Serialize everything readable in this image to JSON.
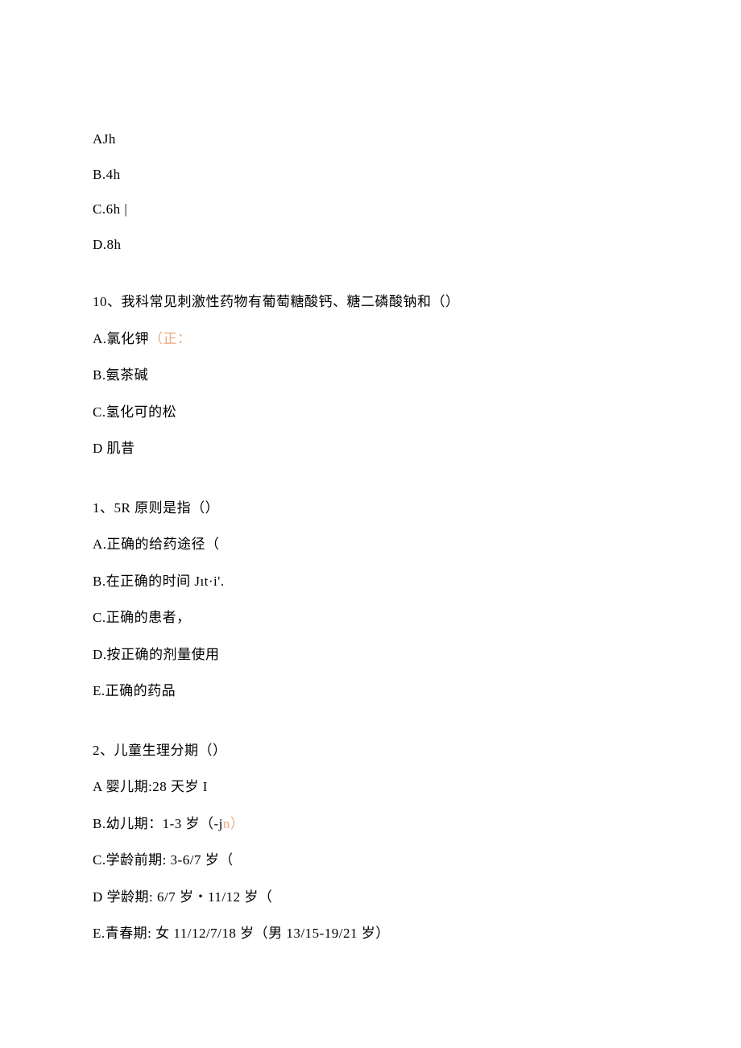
{
  "q9": {
    "optA": "AJh",
    "optB": "B.4h",
    "optC": "C.6h",
    "optD": "D.8h"
  },
  "q10": {
    "stem": "10、我科常见刺激性药物有葡萄糖酸钙、糖二磷酸钠和（）",
    "optA_prefix": "A.氯化钾",
    "optA_orange": "（正：",
    "optB": "B.氨茶碱",
    "optC": "C.氢化可的松",
    "optD": "D 肌昔"
  },
  "q1": {
    "stem": "1、5R 原则是指（）",
    "optA": "A.正确的给药途径（",
    "optB": "B.在正确的时间 Jıt·i'.",
    "optC": "C.正确的患者，",
    "optD": "D.按正确的剂量使用",
    "optE": "E.正确的药品"
  },
  "q2": {
    "stem": "2、儿童生理分期（）",
    "optA": "A 婴儿期:28 天岁 I",
    "optB_prefix": "B.幼儿期：1-3 岁（-j",
    "optB_orange": "n）",
    "optC": "C.学龄前期: 3-6/7 岁（",
    "optD": "D 学龄期: 6/7 岁・11/12 岁（",
    "optE": "E.青春期: 女 11/12/7/18 岁（男 13/15-19/21 岁）"
  }
}
